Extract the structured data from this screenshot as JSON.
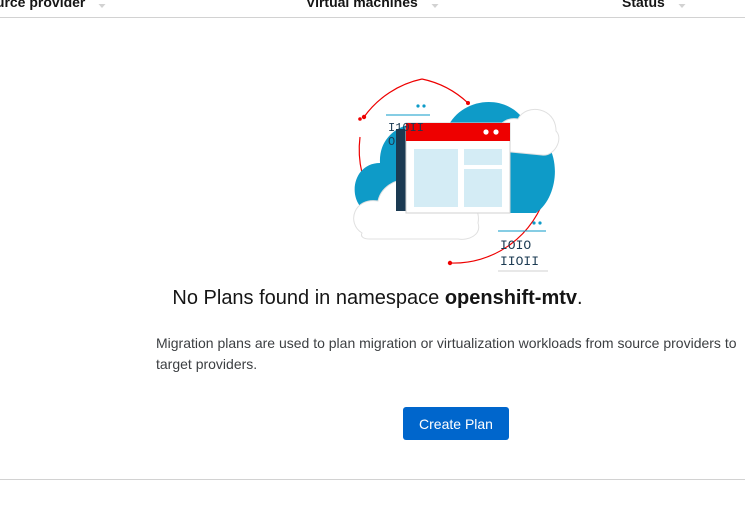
{
  "table": {
    "columns": [
      {
        "label": "Source provider",
        "icon": "sort-icon"
      },
      {
        "label": "Virtual machines",
        "icon": "sort-icon"
      },
      {
        "label": "Status",
        "icon": "sort-icon"
      }
    ]
  },
  "empty_state": {
    "title_prefix": "No Plans found in namespace ",
    "namespace": "openshift-mtv",
    "title_suffix": ".",
    "body": "Migration plans are used to plan migration or virtualization workloads from source providers to target providers.",
    "action_label": "Create Plan",
    "illustration_text": {
      "top_line1": "I10II",
      "top_line2": "OI",
      "bottom_line1": "IOIO",
      "bottom_line2": "IIOII"
    }
  },
  "colors": {
    "primary": "#0066cc",
    "accent_red": "#ee0000",
    "cloud_blue": "#0e9bc8",
    "divider": "#d2d2d2"
  }
}
